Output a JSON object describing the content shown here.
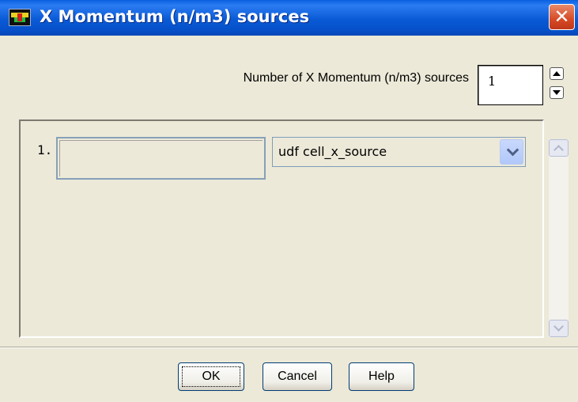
{
  "window": {
    "title": "X Momentum (n/m3) sources",
    "close_label": "✕"
  },
  "count": {
    "label": "Number of X Momentum (n/m3) sources",
    "value": "1"
  },
  "sources": [
    {
      "index_label": "1.",
      "value_text": "",
      "option": "udf cell_x_source"
    }
  ],
  "buttons": {
    "ok": "OK",
    "cancel": "Cancel",
    "help": "Help"
  },
  "colors": {
    "titlebar": "#0a5ad6",
    "dialog_bg": "#ece9d8",
    "close_button": "#d64a25"
  },
  "icons": {
    "app": "fluent-app-icon",
    "close": "close-icon",
    "spin_up": "arrow-up-icon",
    "spin_down": "arrow-down-icon",
    "dropdown": "chevron-down-icon"
  }
}
